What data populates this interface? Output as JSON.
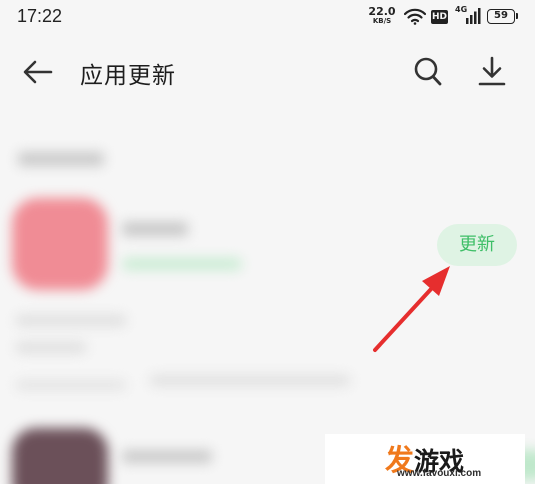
{
  "status_bar": {
    "time": "17:22",
    "net_speed_value": "22.0",
    "net_speed_unit": "KB/S",
    "hd_label": "HD",
    "signal_label": "4G",
    "battery_level": "59"
  },
  "header": {
    "title": "应用更新",
    "icons": [
      "back-arrow-icon",
      "search-icon",
      "download-icon"
    ]
  },
  "list": {
    "update_button_label": "更新"
  },
  "colors": {
    "accent_green": "#3fbf68",
    "button_bg": "#dff3e4",
    "annotation_red": "#e62e2e"
  },
  "watermark": {
    "brand_first": "发",
    "brand_rest": "游戏",
    "url": "www.favouxi.com"
  }
}
